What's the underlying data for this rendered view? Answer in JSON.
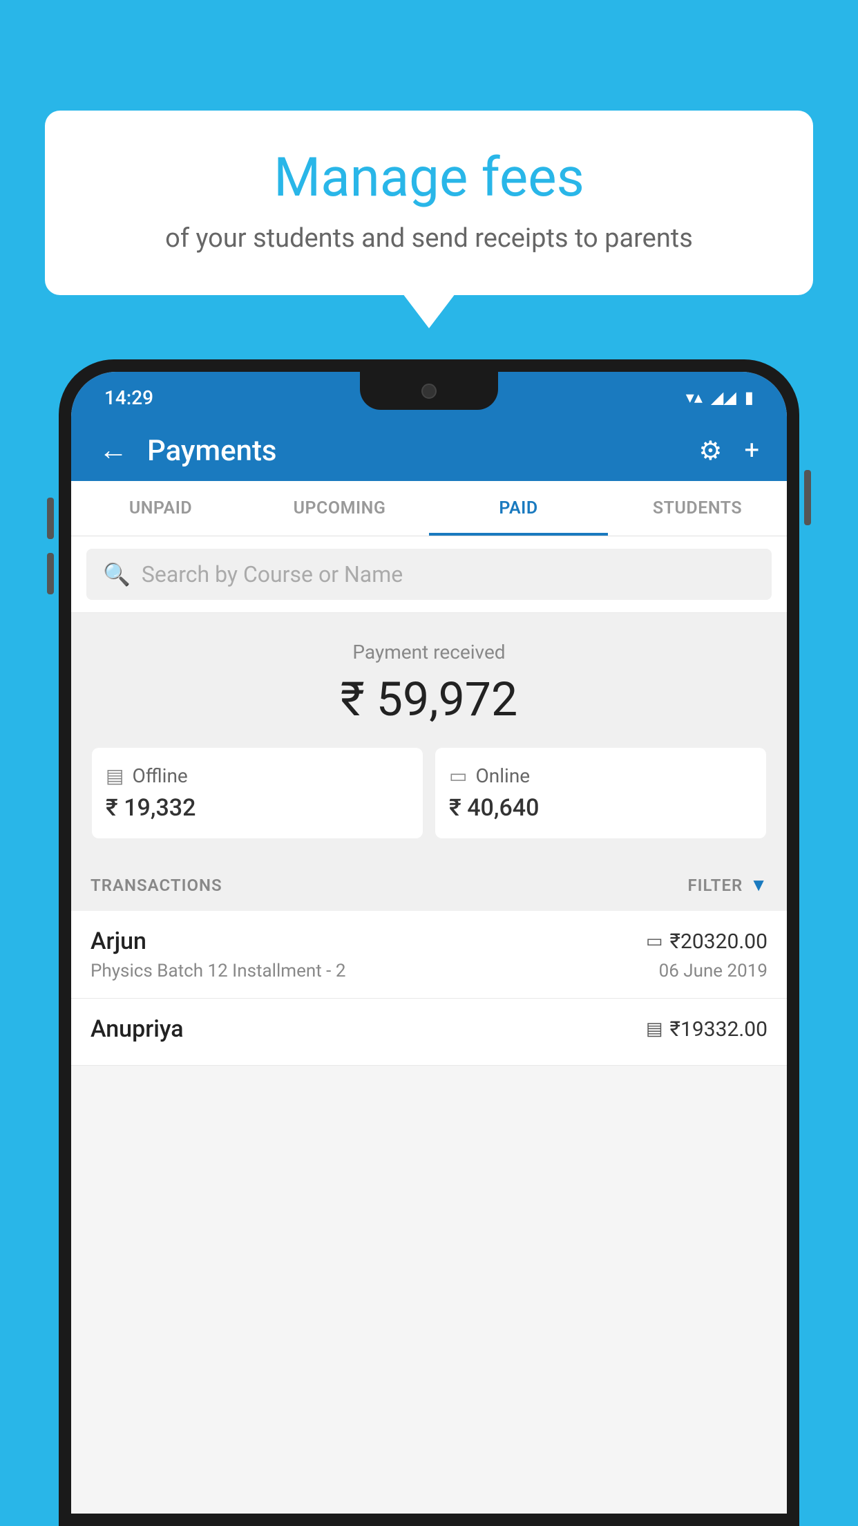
{
  "background_color": "#29b6e8",
  "speech_bubble": {
    "title": "Manage fees",
    "subtitle": "of your students and send receipts to parents"
  },
  "status_bar": {
    "time": "14:29",
    "wifi": "▼▲",
    "signal": "▲▲",
    "battery": "▮"
  },
  "header": {
    "title": "Payments",
    "back_label": "←",
    "gear_label": "⚙",
    "plus_label": "+"
  },
  "tabs": [
    {
      "label": "UNPAID",
      "active": false
    },
    {
      "label": "UPCOMING",
      "active": false
    },
    {
      "label": "PAID",
      "active": true
    },
    {
      "label": "STUDENTS",
      "active": false
    }
  ],
  "search": {
    "placeholder": "Search by Course or Name"
  },
  "payment_summary": {
    "received_label": "Payment received",
    "total_amount": "₹ 59,972",
    "offline": {
      "label": "Offline",
      "amount": "₹ 19,332"
    },
    "online": {
      "label": "Online",
      "amount": "₹ 40,640"
    }
  },
  "transactions": {
    "section_label": "TRANSACTIONS",
    "filter_label": "FILTER",
    "items": [
      {
        "name": "Arjun",
        "mode_icon": "▭",
        "amount": "₹20320.00",
        "course": "Physics Batch 12 Installment - 2",
        "date": "06 June 2019"
      },
      {
        "name": "Anupriya",
        "mode_icon": "▤",
        "amount": "₹19332.00",
        "course": "",
        "date": ""
      }
    ]
  }
}
